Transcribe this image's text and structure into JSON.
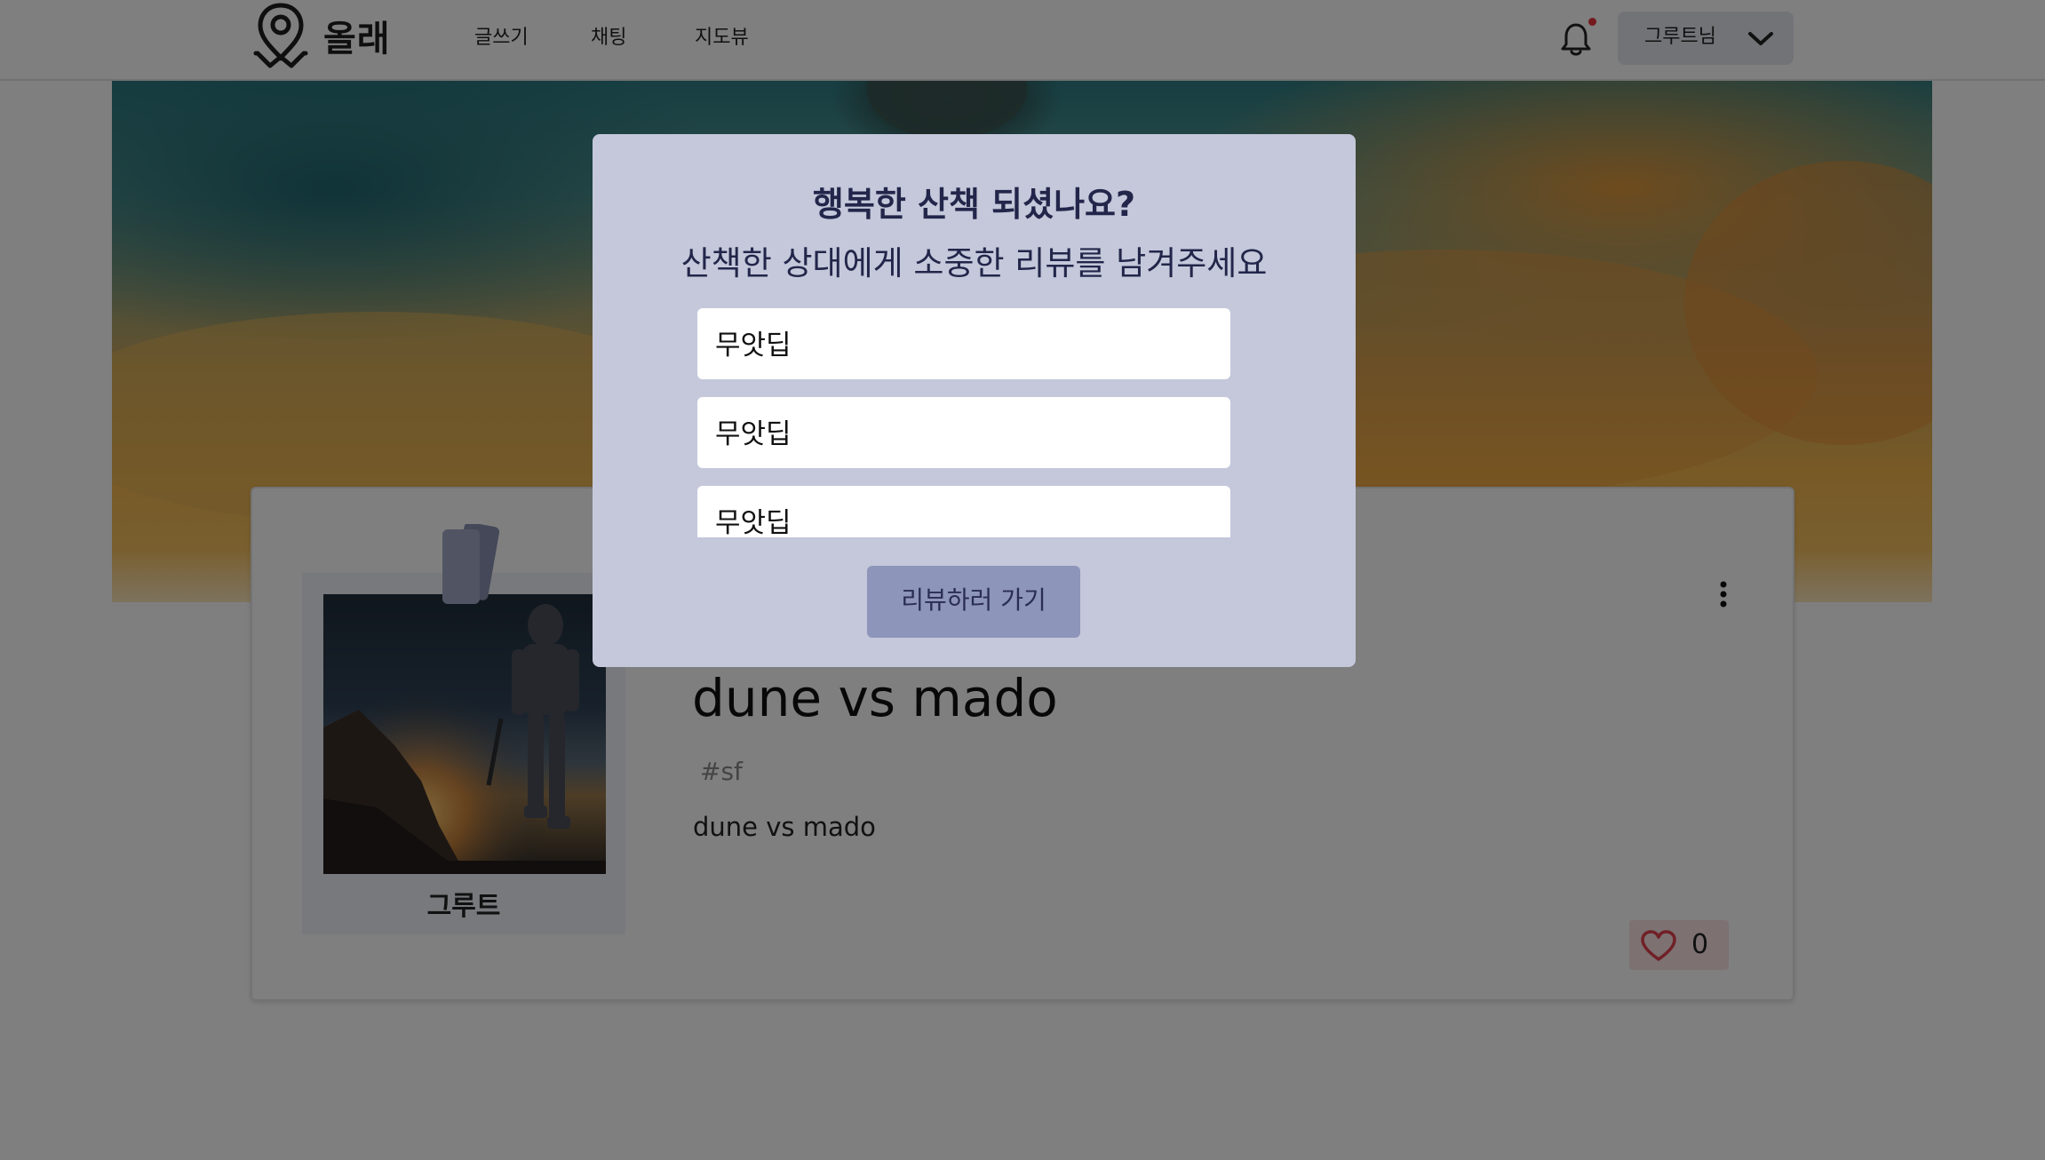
{
  "header": {
    "logo_text": "올래",
    "nav": [
      {
        "label": "글쓰기"
      },
      {
        "label": "채팅"
      },
      {
        "label": "지도뷰"
      }
    ],
    "user_name": "그루트님",
    "notification_dot_color": "#e8323c"
  },
  "post": {
    "author": "그루트",
    "title": "dune vs mado",
    "tag": "#sf",
    "body": "dune vs mado",
    "like_count": "0"
  },
  "modal": {
    "title": "행복한 산책 되셨나요?",
    "subtitle": "산책한 상대에게 소중한 리뷰를 남겨주세요",
    "options": [
      {
        "label": "무앗딥"
      },
      {
        "label": "무앗딥"
      },
      {
        "label": "무앗딥"
      }
    ],
    "button_label": "리뷰하러 가기",
    "colors": {
      "background": "#c4c8da",
      "button": "#8e95ba",
      "text": "#23264a"
    }
  }
}
